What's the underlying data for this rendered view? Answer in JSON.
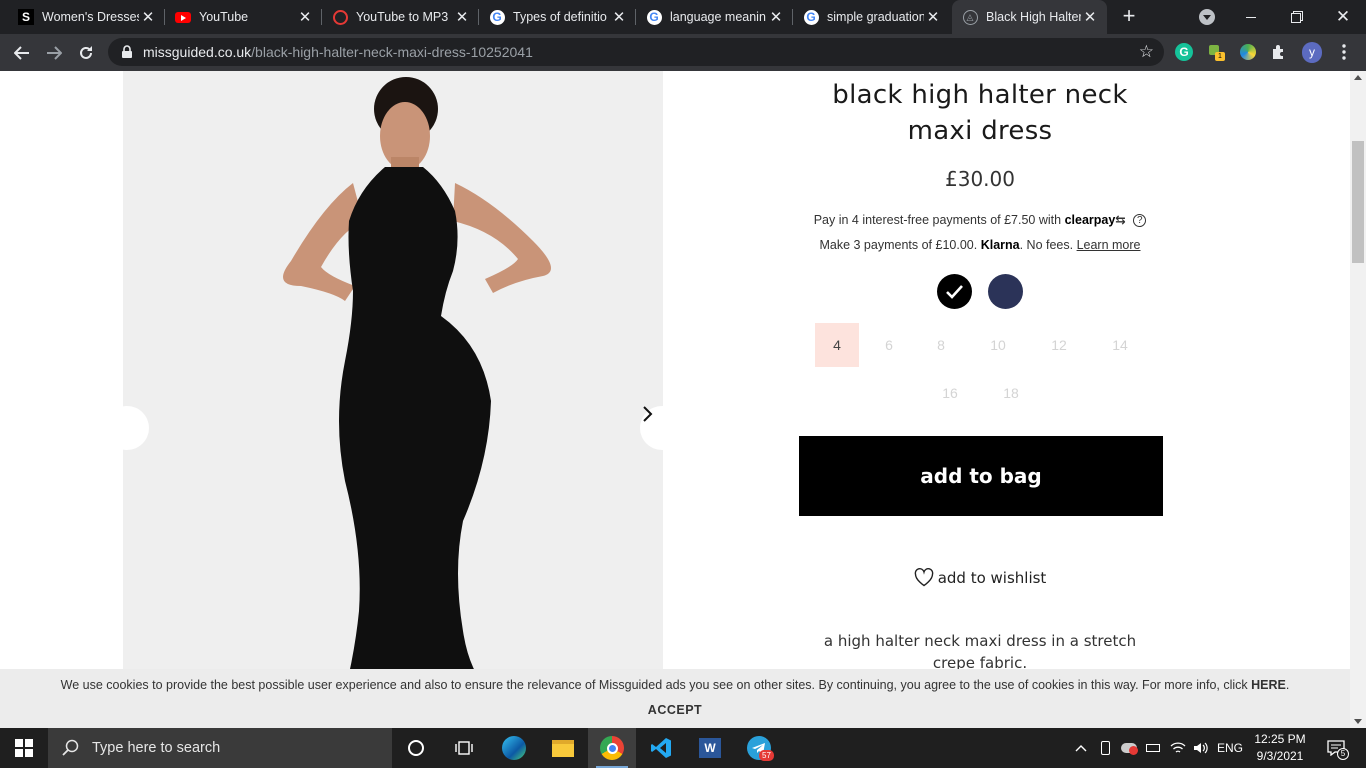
{
  "browser": {
    "tabs": [
      {
        "title": "Women's Dresses",
        "favicon": "s-letter-icon"
      },
      {
        "title": "YouTube",
        "favicon": "youtube-icon"
      },
      {
        "title": "YouTube to MP3",
        "favicon": "red-circle-icon"
      },
      {
        "title": "Types of definitio",
        "favicon": "google-icon"
      },
      {
        "title": "language meanin",
        "favicon": "google-icon"
      },
      {
        "title": "simple graduation",
        "favicon": "google-icon"
      },
      {
        "title": "Black High Halter",
        "favicon": "missguided-icon"
      }
    ],
    "url_host": "missguided.co.uk",
    "url_path": "/black-high-halter-neck-maxi-dress-10252041",
    "profile_initial": "y"
  },
  "product": {
    "title": "black high halter neck maxi dress",
    "price": "£30.00",
    "clearpay_text": "Pay in 4 interest-free payments of £7.50 with",
    "clearpay_brand": "clearpay",
    "klarna_prefix": "Make 3 payments of £10.00.",
    "klarna_brand": "Klarna",
    "klarna_suffix": ". No fees.",
    "learn_more": "Learn more",
    "colours": [
      {
        "name": "black",
        "hex": "#000000",
        "selected": true
      },
      {
        "name": "navy",
        "hex": "#2b3358",
        "selected": false
      }
    ],
    "sizes": [
      {
        "label": "4",
        "selected": true
      },
      {
        "label": "6"
      },
      {
        "label": "8"
      },
      {
        "label": "10"
      },
      {
        "label": "12"
      },
      {
        "label": "14"
      },
      {
        "label": "16"
      },
      {
        "label": "18"
      }
    ],
    "add_to_bag": "add to bag",
    "add_to_wishlist": "add to wishlist",
    "description": "a high halter neck maxi dress in a stretch crepe fabric."
  },
  "cookie_banner": {
    "text": "We use cookies to provide the best possible user experience and also to ensure the relevance of Missguided ads you see on other sites. By continuing, you agree to the use of cookies in this way. For more info, click",
    "link": "HERE",
    "accept": "ACCEPT"
  },
  "taskbar": {
    "search_placeholder": "Type here to search",
    "language": "ENG",
    "time": "12:25 PM",
    "date": "9/3/2021",
    "telegram_badge": "57",
    "notification_count": "5"
  },
  "colors": {
    "accent_size_selected": "#fde3dd",
    "button_black": "#000000"
  }
}
